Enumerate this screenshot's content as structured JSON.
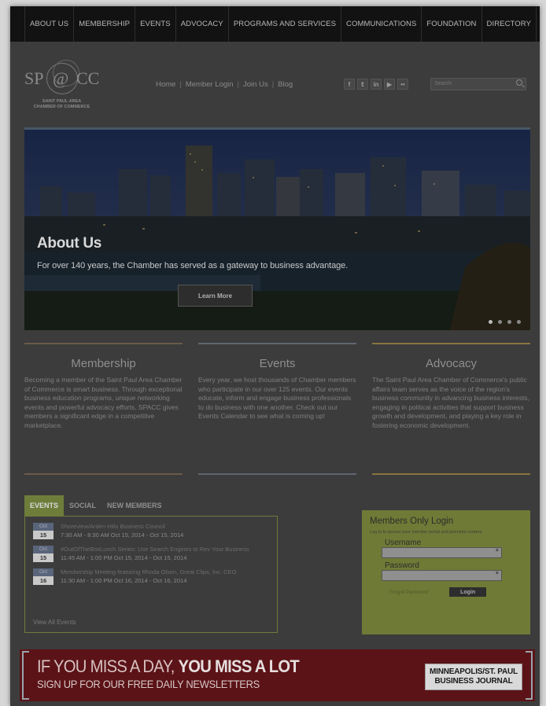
{
  "topnav": {
    "items": [
      "ABOUT US",
      "MEMBERSHIP",
      "EVENTS",
      "ADVOCACY",
      "PROGRAMS AND SERVICES",
      "COMMUNICATIONS",
      "FOUNDATION",
      "DIRECTORY"
    ]
  },
  "logo": {
    "mark_left": "SP",
    "mark_mid": "@",
    "mark_right": "CC",
    "line1": "SAINT PAUL AREA",
    "line2": "CHAMBER OF COMMERCE"
  },
  "header_links": {
    "home": "Home",
    "member_login": "Member Login",
    "join_us": "Join Us",
    "blog": "Blog",
    "separator": "|"
  },
  "social": {
    "icons": [
      {
        "name": "facebook-icon",
        "glyph": "f"
      },
      {
        "name": "twitter-icon",
        "glyph": "𝕥"
      },
      {
        "name": "linkedin-icon",
        "glyph": "in"
      },
      {
        "name": "youtube-icon",
        "glyph": "▶"
      },
      {
        "name": "flickr-icon",
        "glyph": "••"
      }
    ]
  },
  "search": {
    "placeholder": "Search"
  },
  "hero": {
    "title": "About Us",
    "text": "For over 140 years, the Chamber has served as a gateway to business advantage.",
    "button": "Learn More",
    "slides": 4
  },
  "columns": [
    {
      "title": "Membership",
      "rule_color": "#6b5a4a",
      "text": "Becoming a member of the Saint Paul Area Chamber of Commerce is smart business. Through exceptional business education programs, unique networking events and powerful advocacy efforts, SPACC gives members a significant edge in a competitive marketplace."
    },
    {
      "title": "Events",
      "rule_color": "#5f6670",
      "text": "Every year, we host thousands of Chamber members who participate in our over 125 events. Our events educate, inform and engage business professionals to do business with one another. Check out our Events Calendar to see what is coming up!"
    },
    {
      "title": "Advocacy",
      "rule_color": "#8a7440",
      "text": "The Saint Paul Area Chamber of Commerce's public affairs team serves as the voice of the region's business community in advancing business interests, engaging in political activities that support business growth and development, and playing a key role in fostering economic development."
    }
  ],
  "tabs": {
    "labels": [
      "EVENTS",
      "SOCIAL",
      "NEW MEMBERS"
    ],
    "active": "EVENTS",
    "events": [
      {
        "month": "Oct",
        "day": "15",
        "title": "Shoreview/Arden Hills Business Council",
        "time": "7:30 AM - 8:30 AM Oct 15, 2014 - Oct 15, 2014"
      },
      {
        "month": "Oct",
        "day": "15",
        "title": "#OutOfTheBoxLunch Series: Use Search Engines to Rev Your Business",
        "time": "11:45 AM - 1:00 PM Oct 15, 2014 - Oct 15, 2014"
      },
      {
        "month": "Oct",
        "day": "16",
        "title": "Membership Meeting featuring Rhoda Olsen, Great Clips, Inc. CEO",
        "time": "11:30 AM - 1:00 PM Oct 16, 2014 - Oct 16, 2014"
      }
    ],
    "view_all": "View All Events"
  },
  "login": {
    "title": "Members Only Login",
    "note": "Log in to access your member portal and premium content.",
    "username_label": "Username",
    "password_label": "Password",
    "required_mark": "*",
    "forgot": "Forgot Password",
    "button": "Login"
  },
  "banner": {
    "line1_a": "IF YOU MISS A DAY, ",
    "line1_b": "YOU MISS A LOT",
    "line2": "SIGN UP FOR OUR FREE DAILY NEWSLETTERS",
    "logo_line1": "MINNEAPOLIS/ST. PAUL",
    "logo_line2": "BUSINESS JOURNAL"
  }
}
